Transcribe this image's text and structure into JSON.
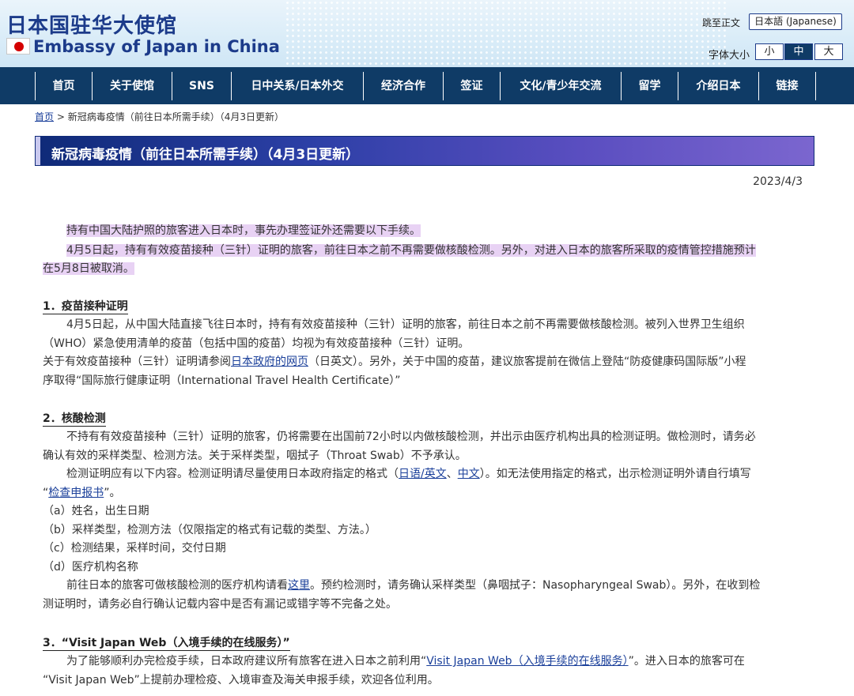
{
  "header": {
    "title_cn": "日本国驻华大使馆",
    "title_en": "Embassy of Japan in China",
    "skip_link": "跳至正文",
    "language_button": "日本語 (Japanese)",
    "font_size_label": "字体大小",
    "font_sizes": [
      "小",
      "中",
      "大"
    ]
  },
  "nav": {
    "items": [
      "首页",
      "关于使馆",
      "SNS",
      "日中关系/日本外交",
      "经济合作",
      "签证",
      "文化/青少年交流",
      "留学",
      "介绍日本",
      "链接"
    ]
  },
  "breadcrumb": {
    "home": "首页",
    "separator": ">",
    "current": "新冠病毒疫情（前往日本所需手续）（4月3日更新）"
  },
  "page": {
    "title": "新冠病毒疫情（前往日本所需手续）（4月3日更新）",
    "date": "2023/4/3"
  },
  "intro": {
    "line1": "持有中国大陆护照的旅客进入日本时，事先办理签证外还需要以下手续。",
    "line2a": "4月5日起，持有有效疫苗接种（三针）证明的旅客，前往日本之前不再需要做核酸检测。另外，对进入日本的旅客所采取的疫情管控措施预计",
    "line2b": "在5月8日被取消。"
  },
  "section1": {
    "heading": "1．疫苗接种证明",
    "p1a": "4月5日起，从中国大陆直接飞往日本时，持有有效疫苗接种（三针）证明的旅客，前往日本之前不再需要做核酸检测。被列入世界卫生组织",
    "p1b": "（WHO）紧急使用清单的疫苗（包括中国的疫苗）均视为有效疫苗接种（三针）证明。",
    "p2_pre": "关于有效疫苗接种（三针）证明请参阅",
    "p2_link": "日本政府的网页",
    "p2_post": "（日英文）。另外，关于中国的疫苗，建议旅客提前在微信上登陆“防疫健康码国际版”小程",
    "p2b": "序取得“国际旅行健康证明（International Travel Health Certificate）”"
  },
  "section2": {
    "heading": "2．核酸检测",
    "p1a": "不持有有效疫苗接种（三针）证明的旅客，仍将需要在出国前72小时以内做核酸检测，并出示由医疗机构出具的检测证明。做检测时，请务必",
    "p1b": "确认有效的采样类型、检测方法。关于采样类型，咽拭子（Throat Swab）不予承认。",
    "p2_pre": "检测证明应有以下内容。检测证明请尽量使用日本政府指定的格式（",
    "p2_link1": "日语/英文",
    "p2_sep": "、",
    "p2_link2": "中文",
    "p2_post": "）。如无法使用指定的格式，出示检测证明外请自行填写",
    "p3_pre": "“",
    "p3_link": "检查申报书",
    "p3_post": "”。",
    "items": [
      "（a）姓名，出生日期",
      "（b）采样类型，检测方法（仅限指定的格式有记载的类型、方法。）",
      "（c）检测结果，采样时间，交付日期",
      "（d）医疗机构名称"
    ],
    "p4_pre": "前往日本的旅客可做核酸检测的医疗机构请看",
    "p4_link": "这里",
    "p4_post": "。预约检测时，请务确认采样类型（鼻咽拭子：Nasopharyngeal Swab）。另外，在收到检",
    "p4b": "测证明时，请务必自行确认记载内容中是否有漏记或错字等不完备之处。"
  },
  "section3": {
    "heading": "3．“Visit Japan Web（入境手续的在线服务）”",
    "p1_pre": "为了能够顺利办完检疫手续，日本政府建议所有旅客在进入日本之前利用“",
    "p1_link": "Visit Japan Web（入境手续的在线服务）",
    "p1_post": "”。进入日本的旅客可在",
    "p1b": "“Visit Japan Web”上提前办理检疫、入境审查及海关申报手续，欢迎各位利用。"
  }
}
